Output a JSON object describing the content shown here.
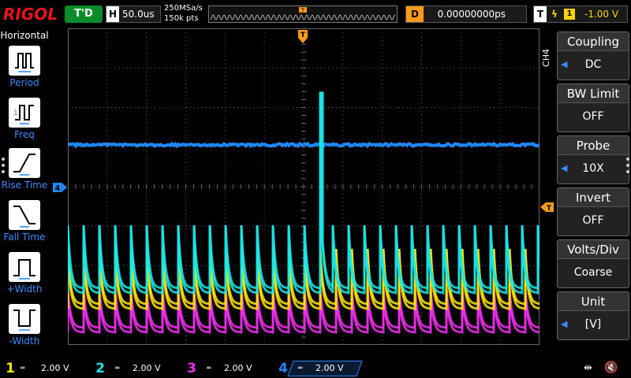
{
  "header": {
    "brand": "RIGOL",
    "trigger_status": "T'D",
    "horizontal_label": "H",
    "timebase": "50.0us",
    "sample_rate": "250MSa/s",
    "memory_depth": "150k pts",
    "delay_label": "D",
    "delay_value": "0.00000000ps",
    "trigger_label": "T",
    "trigger_source": "1",
    "trigger_level": "-1.00 V"
  },
  "left_menu": {
    "title": "Horizontal",
    "items": [
      {
        "label": "Period",
        "icon": "period-icon"
      },
      {
        "label": "Freq",
        "icon": "frequency-icon"
      },
      {
        "label": "Rise Time",
        "icon": "rise-time-icon"
      },
      {
        "label": "Fall Time",
        "icon": "fall-time-icon"
      },
      {
        "label": "+Width",
        "icon": "positive-width-icon"
      },
      {
        "label": "-Width",
        "icon": "negative-width-icon"
      }
    ]
  },
  "right_menu": {
    "channel_tag": "CH4",
    "items": [
      {
        "title": "Coupling",
        "value": "DC",
        "has_arrow": true
      },
      {
        "title": "BW Limit",
        "value": "OFF",
        "has_arrow": false
      },
      {
        "title": "Probe",
        "value": "10X",
        "has_arrow": true
      },
      {
        "title": "Invert",
        "value": "OFF",
        "has_arrow": false
      },
      {
        "title": "Volts/Div",
        "value": "Coarse",
        "has_arrow": false
      },
      {
        "title": "Unit",
        "value": "[V]",
        "has_arrow": true
      }
    ]
  },
  "channels": [
    {
      "num": "1",
      "scale": "2.00 V",
      "color": "#ffe600",
      "active": false
    },
    {
      "num": "2",
      "scale": "2.00 V",
      "color": "#19e6e6",
      "active": false
    },
    {
      "num": "3",
      "scale": "2.00 V",
      "color": "#ee2eee",
      "active": false
    },
    {
      "num": "4",
      "scale": "2.00 V",
      "color": "#1f88ff",
      "active": true
    }
  ],
  "markers": {
    "trigger_position": "T",
    "trigger_level_marker": "T",
    "ch4_offset_marker": "4"
  },
  "colors": {
    "ch1": "#ffe600",
    "ch2": "#19e6e6",
    "ch3": "#ee2eee",
    "ch4": "#1f88ff",
    "brand": "#e8141b",
    "trigger_status_bg": "#0a8c2a",
    "delay_accent": "#ff9a1a"
  }
}
